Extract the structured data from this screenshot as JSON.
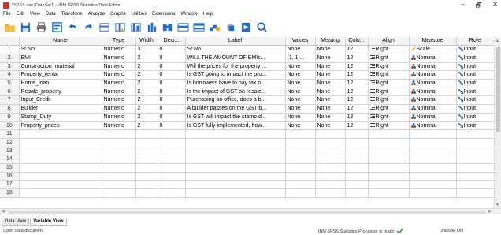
{
  "window": {
    "title": "*SPSS.sav [DataSet1] - IBM SPSS Statistics Data Editor",
    "controls": [
      "–",
      "🗗",
      "✕"
    ]
  },
  "menu": [
    "File",
    "Edit",
    "View",
    "Data",
    "Transform",
    "Analyze",
    "Graphs",
    "Utilities",
    "Extensions",
    "Window",
    "Help"
  ],
  "toolbar_icons": [
    "open-icon",
    "save-icon",
    "print-icon",
    "recall-dialog-icon",
    "undo-icon",
    "redo-icon",
    "goto-case-icon",
    "goto-variable-icon",
    "variables-icon",
    "run-descriptives-icon",
    "find-icon",
    "insert-cases-icon",
    "insert-variable-icon",
    "split-file-icon",
    "weight-cases-icon",
    "select-cases-icon",
    "value-labels-icon",
    "search-icon"
  ],
  "columns": [
    "",
    "Name",
    "Type",
    "Width",
    "Deci...",
    "Label",
    "Values",
    "Missing",
    "Colu...",
    "Align",
    "Measure",
    "Role"
  ],
  "rows": [
    {
      "n": "1",
      "name": "Sr.No",
      "type": "Numeric",
      "width": "3",
      "dec": "0",
      "label": "Sr.No.",
      "values": "None",
      "missing": "None",
      "cols": "12",
      "align": "Right",
      "measure": "Scale",
      "role": "Input"
    },
    {
      "n": "2",
      "name": "EMI",
      "type": "Numeric",
      "width": "2",
      "dec": "0",
      "label": "WILL THE AMOUNT OF EMIs...",
      "values": "{1, 1}...",
      "missing": "None",
      "cols": "12",
      "align": "Right",
      "measure": "Nominal",
      "role": "Input"
    },
    {
      "n": "3",
      "name": "Construction_material",
      "type": "Numeric",
      "width": "2",
      "dec": "0",
      "label": "Will the prices for the property ...",
      "values": "None",
      "missing": "None",
      "cols": "12",
      "align": "Right",
      "measure": "Nominal",
      "role": "Input"
    },
    {
      "n": "4",
      "name": "Property_rental",
      "type": "Numeric",
      "width": "2",
      "dec": "0",
      "label": "Is GST going to impact the pro...",
      "values": "None",
      "missing": "None",
      "cols": "12",
      "align": "Right",
      "measure": "Nominal",
      "role": "Input"
    },
    {
      "n": "5",
      "name": "Home_loan",
      "type": "Numeric",
      "width": "2",
      "dec": "0",
      "label": "Is borrowers have to pay tax o...",
      "values": "None",
      "missing": "None",
      "cols": "12",
      "align": "Right",
      "measure": "Nominal",
      "role": "Input"
    },
    {
      "n": "6",
      "name": "Resale_property",
      "type": "Numeric",
      "width": "2",
      "dec": "0",
      "label": "Is the impact of GST on resale...",
      "values": "None",
      "missing": "None",
      "cols": "12",
      "align": "Right",
      "measure": "Nominal",
      "role": "Input"
    },
    {
      "n": "7",
      "name": "Input_Credit",
      "type": "Numeric",
      "width": "2",
      "dec": "0",
      "label": "Purchasing an office, does a b...",
      "values": "None",
      "missing": "None",
      "cols": "12",
      "align": "Right",
      "measure": "Nominal",
      "role": "Input"
    },
    {
      "n": "8",
      "name": "Builder",
      "type": "Numeric",
      "width": "2",
      "dec": "0",
      "label": "A builder passes on the GST b...",
      "values": "None",
      "missing": "None",
      "cols": "12",
      "align": "Right",
      "measure": "Nominal",
      "role": "Input"
    },
    {
      "n": "9",
      "name": "Stamp_Duty",
      "type": "Numeric",
      "width": "2",
      "dec": "0",
      "label": "Is GST will impact the stamp d...",
      "values": "None",
      "missing": "None",
      "cols": "12",
      "align": "Right",
      "measure": "Nominal",
      "role": "Input"
    },
    {
      "n": "10",
      "name": "Property_prices",
      "type": "Numeric",
      "width": "2",
      "dec": "0",
      "label": "Is GST fully implemented, how...",
      "values": "None",
      "missing": "None",
      "cols": "12",
      "align": "Right",
      "measure": "Nominal",
      "role": "Input"
    },
    {
      "n": "11"
    },
    {
      "n": "12"
    },
    {
      "n": "13"
    },
    {
      "n": "14"
    },
    {
      "n": "15"
    },
    {
      "n": "16"
    },
    {
      "n": "17"
    },
    {
      "n": "18"
    }
  ],
  "tabs": [
    "Data View",
    "Variable View"
  ],
  "active_tab": "Variable View",
  "status": {
    "left": "Open data document",
    "processor": "IBM SPSS Statistics Processor is ready",
    "unicode": "Unicode:ON"
  },
  "colors": {
    "blue_icon": "#1e6fd0",
    "scale_icon": "#e9a11a",
    "nominal_icon": "#c0392b",
    "role_icon": "#1d5fbf",
    "status_ok": "#2e9b2e"
  }
}
